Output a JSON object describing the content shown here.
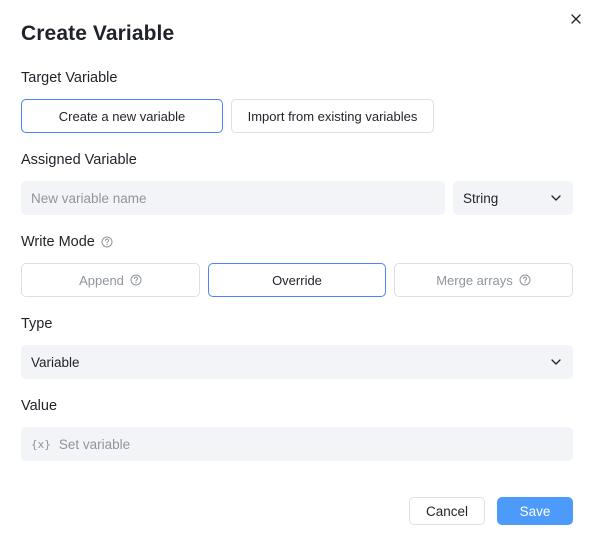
{
  "dialog": {
    "title": "Create Variable"
  },
  "target_variable": {
    "label": "Target Variable",
    "options": [
      {
        "label": "Create a new variable",
        "selected": true
      },
      {
        "label": "Import from existing variables",
        "selected": false
      }
    ]
  },
  "assigned_variable": {
    "label": "Assigned Variable",
    "name_placeholder": "New variable name",
    "type_value": "String"
  },
  "write_mode": {
    "label": "Write Mode",
    "options": [
      {
        "label": "Append",
        "selected": false,
        "disabled": true
      },
      {
        "label": "Override",
        "selected": true,
        "disabled": false
      },
      {
        "label": "Merge arrays",
        "selected": false,
        "disabled": true
      }
    ]
  },
  "type_field": {
    "label": "Type",
    "value": "Variable"
  },
  "value_field": {
    "label": "Value",
    "icon_text": "{x}",
    "placeholder": "Set variable"
  },
  "footer": {
    "cancel_label": "Cancel",
    "save_label": "Save"
  },
  "colors": {
    "accent": "#4e83fd",
    "primary_button": "#4c9bfa",
    "input_bg": "#f3f4f7",
    "border": "#dee0e3",
    "muted_text": "#8f959e"
  }
}
